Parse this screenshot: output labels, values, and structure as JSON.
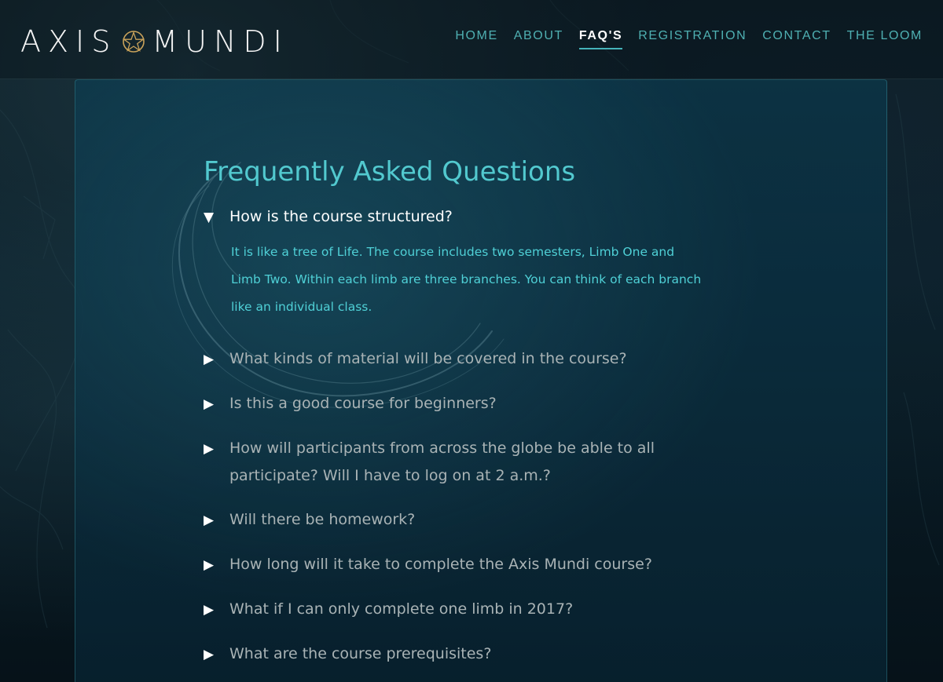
{
  "header": {
    "logo_left": "AXIS",
    "logo_right": "MUNDI",
    "logo_seal": "pentacle-icon",
    "nav": [
      {
        "label": "HOME",
        "active": false
      },
      {
        "label": "ABOUT",
        "active": false
      },
      {
        "label": "FAQ'S",
        "active": true
      },
      {
        "label": "REGISTRATION",
        "active": false
      },
      {
        "label": "CONTACT",
        "active": false
      },
      {
        "label": "THE LOOM",
        "active": false
      }
    ]
  },
  "faq": {
    "title": "Frequently Asked Questions",
    "items": [
      {
        "question": "How is the course structured?",
        "open": true,
        "answer": "It is like a tree of Life. The course includes two semesters, Limb One and Limb Two. Within each limb are three branches. You can think of each branch like an individual class."
      },
      {
        "question": "What kinds of material will be covered in the course?",
        "open": false
      },
      {
        "question": "Is this a good course for beginners?",
        "open": false
      },
      {
        "question": "How will participants from across the globe be able to all participate? Will I have to log on at 2 a.m.?",
        "open": false
      },
      {
        "question": "Will there be homework?",
        "open": false
      },
      {
        "question": "How long will it take to complete the Axis Mundi course?",
        "open": false
      },
      {
        "question": "What if I can only complete one limb in 2017?",
        "open": false
      },
      {
        "question": "What are the course prerequisites?",
        "open": false
      }
    ],
    "arrow_open": "▼",
    "arrow_closed": "▶"
  },
  "colors": {
    "accent": "#52c9cf",
    "nav": "#4fb0b2",
    "question": "#a9b3b5",
    "seal": "#c9a25a"
  }
}
